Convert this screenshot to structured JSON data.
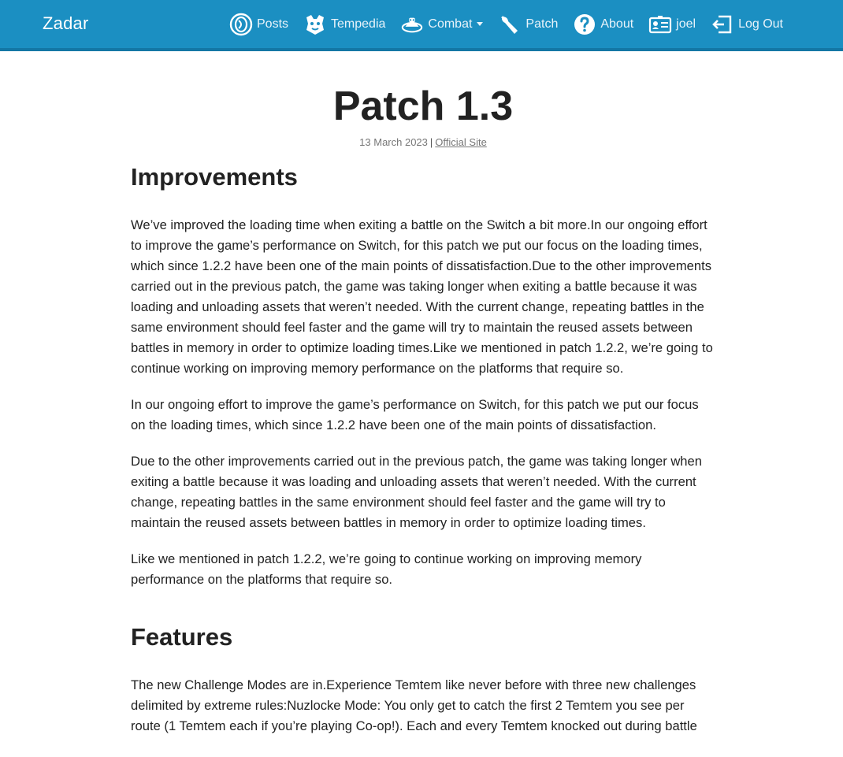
{
  "navbar": {
    "brand": "Zadar",
    "items": [
      {
        "label": "Posts",
        "icon": "disc-icon"
      },
      {
        "label": "Tempedia",
        "icon": "tempedia-icon"
      },
      {
        "label": "Combat",
        "icon": "combat-icon",
        "dropdown": true
      },
      {
        "label": "Patch",
        "icon": "wrench-icon"
      },
      {
        "label": "About",
        "icon": "question-icon"
      },
      {
        "label": "joel",
        "icon": "id-card-icon"
      },
      {
        "label": "Log Out",
        "icon": "logout-icon"
      }
    ],
    "colors": {
      "background": "#1b8fc2",
      "border": "#1377a5",
      "text": "#e8f3fa"
    }
  },
  "post": {
    "title": "Patch 1.3",
    "date": "13 March 2023",
    "separator": "|",
    "source_link": "Official Site",
    "sections": [
      {
        "heading": "Improvements",
        "paragraphs": [
          "We’ve improved the loading time when exiting a battle on the Switch a bit more.In our ongoing effort to improve the game’s performance on Switch, for this patch we put our focus on the loading times, which since 1.2.2 have been one of the main points of dissatisfaction.Due to the other improvements carried out in the previous patch, the game was taking longer when exiting a battle because it was loading and unloading assets that weren’t needed. With the current change, repeating battles in the same environment should feel faster and the game will try to maintain the reused assets between battles in memory in order to optimize loading times.Like we mentioned in patch 1.2.2, we’re going to continue working on improving memory performance on the platforms that require so.",
          "In our ongoing effort to improve the game’s performance on Switch, for this patch we put our focus on the loading times, which since 1.2.2 have been one of the main points of dissatisfaction.",
          "Due to the other improvements carried out in the previous patch, the game was taking longer when exiting a battle because it was loading and unloading assets that weren’t needed. With the current change, repeating battles in the same environment should feel faster and the game will try to maintain the reused assets between battles in memory in order to optimize loading times.",
          "Like we mentioned in patch 1.2.2, we’re going to continue working on improving memory performance on the platforms that require so."
        ]
      },
      {
        "heading": "Features",
        "paragraphs": [
          "The new Challenge Modes are in.Experience Temtem like never before with three new challenges delimited by extreme rules:Nuzlocke Mode: You only get to catch the first 2 Temtem you see per route (1 Temtem each if you’re playing Co-op!). Each and every Temtem knocked out during battle"
        ]
      }
    ]
  }
}
